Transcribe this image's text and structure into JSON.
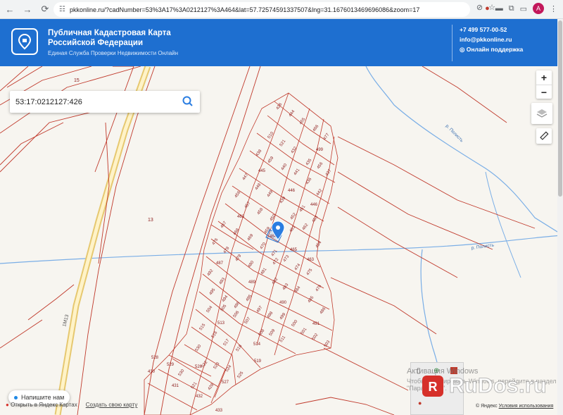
{
  "browser": {
    "url": "pkkonline.ru/?cadNumber=53%3A17%3A0212127%3A464&lat=57.72574591337507&lng=31.1676013469696086&zoom=17",
    "avatar_letter": "A"
  },
  "header": {
    "title_line1": "Публичная Кадастровая Карта",
    "title_line2": "Российской Федерации",
    "subtitle": "Единая Служба Проверки Недвижимости Онлайн",
    "phone": "+7 499 577-00-52",
    "email": "info@pkkonline.ru",
    "support": "Онлайн поддержка",
    "brand_color": "#1e6fd0"
  },
  "search": {
    "value": "53:17:0212127:426"
  },
  "map": {
    "zoom_in": "+",
    "zoom_out": "−",
    "river_label_1": "р. Полисть",
    "river_label_2": "р. Полисть",
    "road_label": "1М13",
    "area_labels": [
      "15",
      "13"
    ],
    "parcel_labels": [
      "426",
      "444",
      "455",
      "466",
      "477",
      "509",
      "488",
      "510",
      "521",
      "432",
      "499",
      "438",
      "459",
      "445",
      "456",
      "447",
      "440",
      "441",
      "457",
      "448",
      "467",
      "458",
      "450",
      "446",
      "449",
      "436",
      "442",
      "463",
      "452",
      "451",
      "462",
      "453",
      "465",
      "455",
      "454",
      "460",
      "471",
      "469",
      "468",
      "476",
      "478",
      "470",
      "472",
      "463",
      "487",
      "481",
      "473",
      "474",
      "479",
      "480",
      "492",
      "489",
      "482",
      "483",
      "484",
      "485",
      "486",
      "486",
      "493",
      "495",
      "496",
      "498",
      "497",
      "495",
      "490",
      "491",
      "505",
      "504",
      "506",
      "507",
      "508",
      "509",
      "500",
      "501",
      "502",
      "503",
      "513",
      "512",
      "511",
      "514",
      "515",
      "516",
      "517",
      "518",
      "519",
      "530",
      "523",
      "524",
      "525",
      "526",
      "527",
      "528",
      "529",
      "430",
      "431",
      "432",
      "433",
      "428"
    ],
    "selected_parcel": "464",
    "parcel_line_color": "#c0392b"
  },
  "overlay": {
    "activation_title": "Активация Windows",
    "activation_sub": "Чтобы активировать Windows, перейдите в раздел \"Параметры\".",
    "watermark": "RuDos.ru"
  },
  "footer": {
    "chat": "Напишите нам",
    "open_yandex": "Открыть в Яндекс Картах",
    "create_map": "Создать свою карту",
    "copyright": "© Яндекс",
    "terms": "Условия использования"
  }
}
